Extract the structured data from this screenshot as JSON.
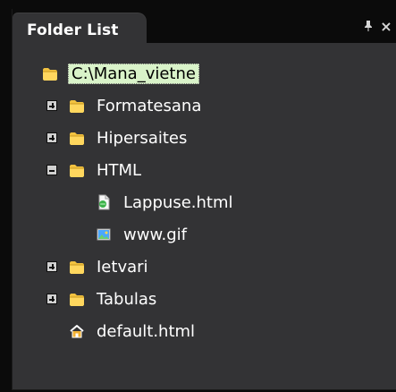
{
  "panel": {
    "title": "Folder List",
    "controls": {
      "pin_icon": "pin-icon",
      "close_glyph": "×",
      "pin_glyph": "📌"
    }
  },
  "tree": {
    "items": [
      {
        "label": "C:\\Mana_vietne",
        "type": "folder",
        "level": 0,
        "toggle": "none",
        "selected": true
      },
      {
        "label": "Formatesana",
        "type": "folder",
        "level": 1,
        "toggle": "plus",
        "selected": false
      },
      {
        "label": "Hipersaites",
        "type": "folder",
        "level": 1,
        "toggle": "plus",
        "selected": false
      },
      {
        "label": "HTML",
        "type": "folder",
        "level": 1,
        "toggle": "minus",
        "selected": false
      },
      {
        "label": "Lappuse.html",
        "type": "html-file",
        "level": 2,
        "toggle": "none",
        "selected": false
      },
      {
        "label": "www.gif",
        "type": "image-file",
        "level": 2,
        "toggle": "none",
        "selected": false
      },
      {
        "label": "Ietvari",
        "type": "folder",
        "level": 1,
        "toggle": "plus",
        "selected": false
      },
      {
        "label": "Tabulas",
        "type": "folder",
        "level": 1,
        "toggle": "plus",
        "selected": false
      },
      {
        "label": "default.html",
        "type": "home-file",
        "level": 1,
        "toggle": "none",
        "selected": false
      }
    ]
  },
  "colors": {
    "panel_bg": "#333335",
    "frame_bg": "#0b0b0b",
    "text": "#ffffff",
    "selection_bg": "#d9f3c9",
    "folder_yellow": "#f5c443"
  }
}
